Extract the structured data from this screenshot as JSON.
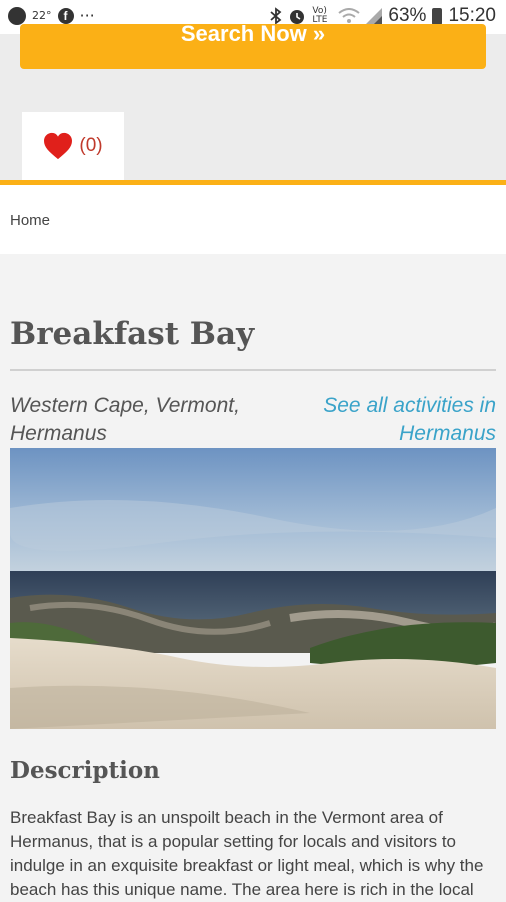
{
  "status_bar": {
    "temperature": "22°",
    "facebook_glyph": "f",
    "more_dots": "···",
    "volte_label": "Vo) LTE",
    "battery_percent": "63%",
    "time": "15:20"
  },
  "search": {
    "label": "Search Now »"
  },
  "favorites": {
    "count_label": "(0)"
  },
  "breadcrumb": {
    "home_label": "Home"
  },
  "page": {
    "title": "Breakfast Bay",
    "location": "Western Cape, Vermont, Hermanus",
    "see_all_link": "See all activities in Hermanus"
  },
  "description": {
    "heading": "Description",
    "text": "Breakfast Bay is an unspoilt beach in the Vermont area of Hermanus, that is a popular setting for locals and visitors to indulge in an exquisite breakfast or light meal, which is why the beach has this unique name. The area here is rich in the local"
  },
  "colors": {
    "accent": "#fbb016",
    "link": "#3aa3c9",
    "heart": "#e0201b"
  },
  "icons": [
    "whatsapp-icon",
    "facebook-icon",
    "bluetooth-icon",
    "alarm-icon",
    "wifi-icon",
    "signal-icon",
    "battery-icon",
    "heart-icon"
  ]
}
